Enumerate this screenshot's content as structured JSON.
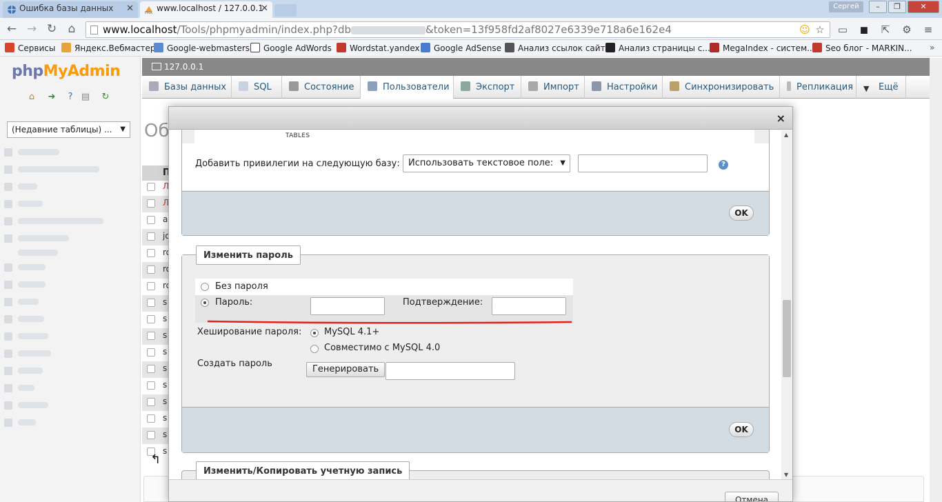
{
  "browser": {
    "tabs": [
      {
        "title": "Ошибка базы данных"
      },
      {
        "title": "www.localhost / 127.0.0.1"
      }
    ],
    "window_user": "Сергей",
    "url": {
      "host": "www.localhost",
      "path": "/Tools/phpmyadmin/index.php?db",
      "query_tail": "&token=13f958fd2af8027e6339e718a6e162e4"
    },
    "bookmarks": [
      {
        "label": "Сервисы",
        "icon": "apps-grid-icon",
        "color": "#d9452b"
      },
      {
        "label": "Яндекс.Вебмастер",
        "icon": "yandex-icon",
        "color": "#e8a23a"
      },
      {
        "label": "Google-webmasters",
        "icon": "google-webmasters-icon",
        "color": "#5a8ad0"
      },
      {
        "label": "Google AdWords",
        "icon": "google-icon",
        "color": "#444444"
      },
      {
        "label": "Wordstat.yandex",
        "icon": "bar-chart-icon",
        "color": "#c0392b"
      },
      {
        "label": "Google AdSense",
        "icon": "page-icon",
        "color": "#4a7bd0"
      },
      {
        "label": "Анализ ссылок сайта",
        "icon": "arrow-link-icon",
        "color": "#333333"
      },
      {
        "label": "Анализ страницы с...",
        "icon": "s-logo-icon",
        "color": "#222222"
      },
      {
        "label": "MegaIndex - систем...",
        "icon": "megaindex-icon",
        "color": "#b02a2a"
      },
      {
        "label": "Seo блог - MARKIN...",
        "icon": "mt-logo-icon",
        "color": "#c0392b"
      }
    ]
  },
  "pma": {
    "logo_php": "php",
    "logo_myadmin": "MyAdmin",
    "recent_tables": "(Недавние таблицы) ...",
    "server": "127.0.0.1",
    "tabs": [
      {
        "label": "Базы данных",
        "icon": "databases-icon"
      },
      {
        "label": "SQL",
        "icon": "sql-icon"
      },
      {
        "label": "Состояние",
        "icon": "status-icon"
      },
      {
        "label": "Пользователи",
        "icon": "users-icon"
      },
      {
        "label": "Экспорт",
        "icon": "export-icon"
      },
      {
        "label": "Импорт",
        "icon": "import-icon"
      },
      {
        "label": "Настройки",
        "icon": "wrench-icon"
      },
      {
        "label": "Синхронизировать",
        "icon": "sync-icon"
      },
      {
        "label": "Репликация",
        "icon": "replication-icon"
      },
      {
        "label": "Ещё",
        "icon": "chevron-down-icon"
      }
    ],
    "background": {
      "heading": "Об",
      "header_letter": "П",
      "row_letters": [
        "Л",
        "Л",
        "a",
        "jo",
        "ro",
        "ro",
        "ro",
        "s",
        "s",
        "s",
        "s",
        "s",
        "s",
        "s",
        "s",
        "s",
        "s"
      ]
    }
  },
  "dialog": {
    "close": "×",
    "privileges": {
      "tables_caption": "TABLES",
      "label": "Добавить привилегии на следующую базу:",
      "select_value": "Использовать текстовое поле:",
      "ok": "OK"
    },
    "change_password": {
      "legend": "Изменить пароль",
      "no_password": "Без пароля",
      "password": "Пароль:",
      "confirm": "Подтверждение:",
      "hashing_label": "Хеширование пароля:",
      "hash_option_1": "MySQL 4.1+",
      "hash_option_2": "Совместимо с MySQL 4.0",
      "generate_label": "Создать пароль",
      "generate_button": "Генерировать",
      "ok": "OK"
    },
    "copy_account": {
      "legend": "Изменить/Копировать учетную запись"
    },
    "cancel": "Отмена"
  }
}
